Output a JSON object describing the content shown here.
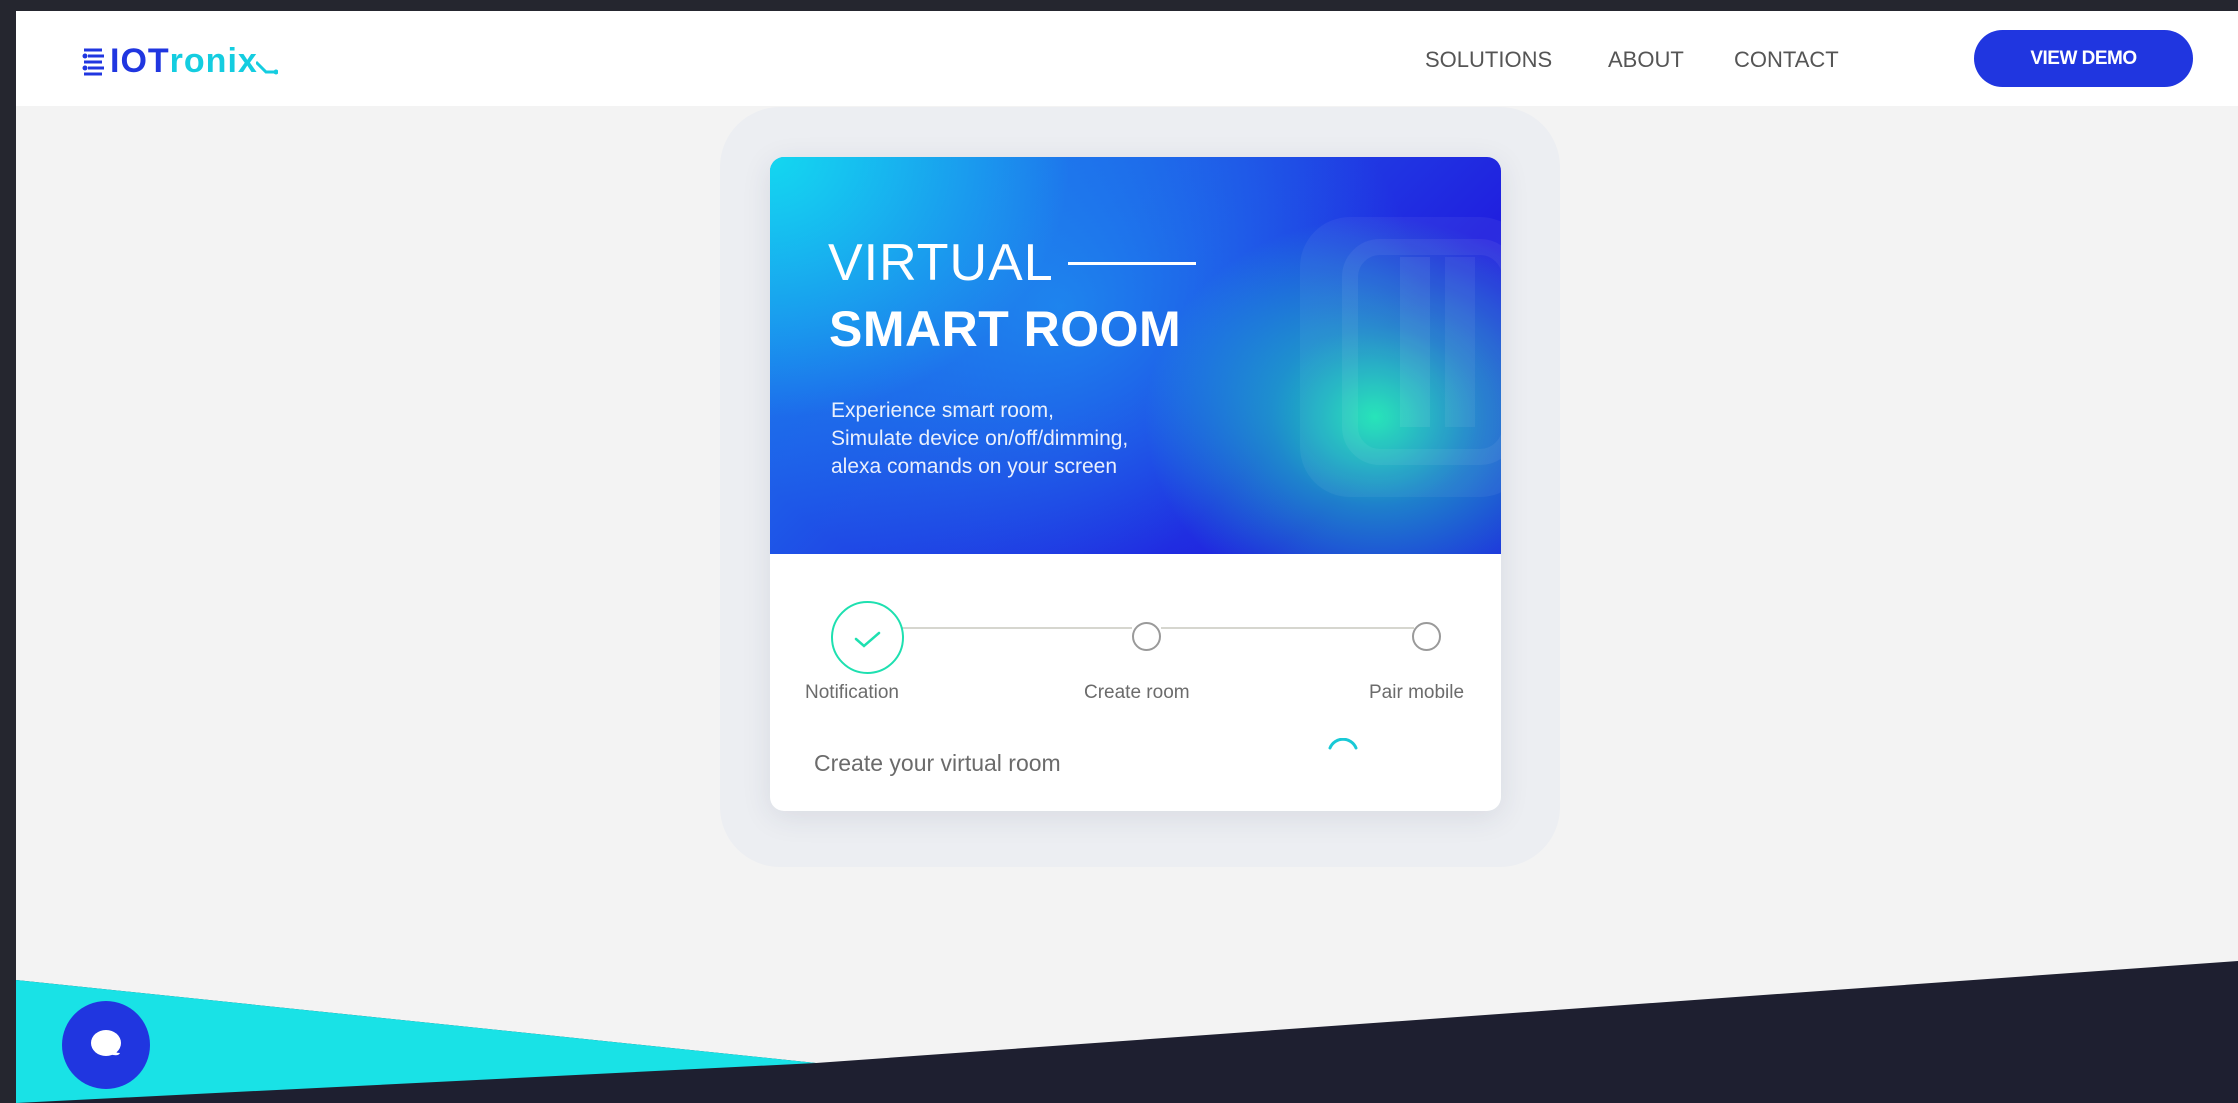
{
  "header": {
    "logo": {
      "part1": "IOT",
      "part2": "ronix"
    },
    "nav": [
      {
        "label": "SOLUTIONS"
      },
      {
        "label": "ABOUT"
      },
      {
        "label": "CONTACT"
      }
    ],
    "cta_label": "VIEW DEMO"
  },
  "banner": {
    "title_line1": "VIRTUAL",
    "title_line2": "SMART ROOM",
    "description": [
      "Experience smart room,",
      "Simulate device on/off/dimming,",
      "alexa comands on your screen"
    ]
  },
  "stepper": {
    "steps": [
      {
        "label": "Notification",
        "state": "completed"
      },
      {
        "label": "Create room",
        "state": "pending"
      },
      {
        "label": "Pair mobile",
        "state": "pending"
      }
    ]
  },
  "status": {
    "text": "Create your virtual room",
    "loading": true
  },
  "colors": {
    "brand": "#2036e0",
    "accent": "#14cde0",
    "success": "#1ee0b0",
    "footer_dark": "#1e1f30",
    "footer_cyan": "#19e2e6"
  },
  "chat": {
    "icon": "chat-bubble-icon"
  }
}
